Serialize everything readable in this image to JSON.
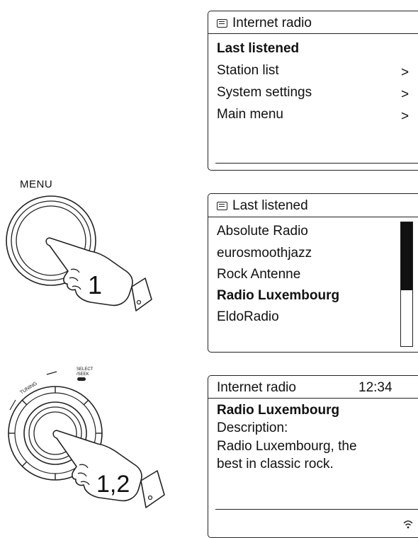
{
  "screen1": {
    "title": "Internet radio",
    "items": [
      {
        "label": "Last listened",
        "arrow": ""
      },
      {
        "label": "Station list",
        "arrow": ">"
      },
      {
        "label": "System settings",
        "arrow": ">"
      },
      {
        "label": "Main menu",
        "arrow": ">"
      }
    ]
  },
  "screen2": {
    "title": "Last listened",
    "items": [
      "Absolute Radio",
      "eurosmoothjazz",
      "Rock Antenne",
      "Radio Luxembourg",
      "EldoRadio"
    ],
    "scroll_position": 0.55
  },
  "screen3": {
    "title": "Internet radio",
    "time": "12:34",
    "station": "Radio Luxembourg",
    "lines": [
      "Description:",
      "Radio Luxembourg, the",
      "best in classic rock."
    ]
  },
  "illustrations": {
    "menu_label": "MENU",
    "step1": "1",
    "step2": "1,2",
    "knob_tuning": "TUNING",
    "knob_select_1": "SELECT",
    "knob_select_2": "/SEEK"
  },
  "icons": [
    "list-icon",
    "pressing-hand-icon",
    "menu-button-icon",
    "tuning-knob-icon",
    "wifi-signal-icon"
  ]
}
